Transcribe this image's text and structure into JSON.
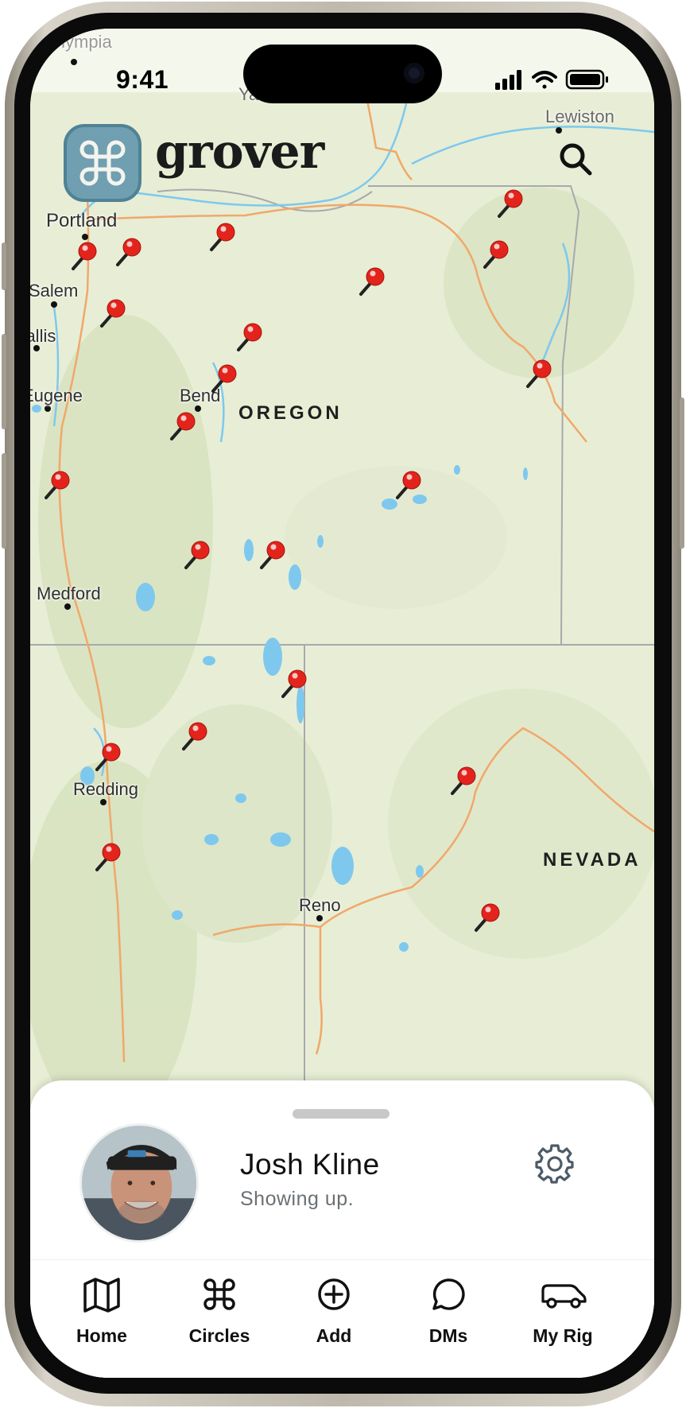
{
  "status_bar": {
    "time": "9:41"
  },
  "app": {
    "name": "grover"
  },
  "map": {
    "cities": [
      {
        "name": "Olympia"
      },
      {
        "name": "Yakima"
      },
      {
        "name": "Lewiston"
      },
      {
        "name": "Portland"
      },
      {
        "name": "Salem"
      },
      {
        "name": "Corvallis"
      },
      {
        "name": "Eugene"
      },
      {
        "name": "Bend"
      },
      {
        "name": "Medford"
      },
      {
        "name": "Redding"
      },
      {
        "name": "Reno"
      }
    ],
    "states": [
      {
        "name": "OREGON"
      },
      {
        "name": "NEVADA"
      }
    ],
    "pin_count": 24
  },
  "profile": {
    "name": "Josh Kline",
    "status": "Showing up."
  },
  "tabs": [
    {
      "label": "Home",
      "icon": "map-icon"
    },
    {
      "label": "Circles",
      "icon": "command-icon"
    },
    {
      "label": "Add",
      "icon": "plus-circle-icon"
    },
    {
      "label": "DMs",
      "icon": "chat-bubble-icon"
    },
    {
      "label": "My Rig",
      "icon": "van-icon"
    }
  ],
  "colors": {
    "pin": "#e3241c",
    "logo": "#6f9fb0",
    "map_land": "#e6edd3",
    "water": "#7ec8ee",
    "road": "#f0a86a"
  }
}
